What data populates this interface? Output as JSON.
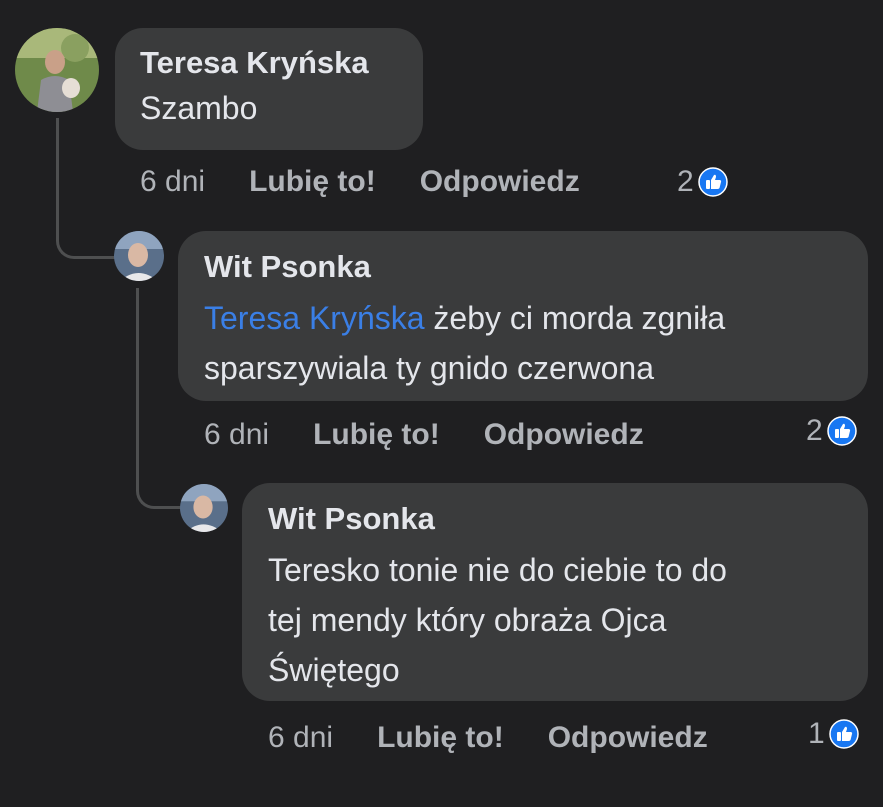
{
  "comments": [
    {
      "author": "Teresa Kryńska",
      "text": "Szambo",
      "time": "6 dni",
      "like_label": "Lubię to!",
      "reply_label": "Odpowiedz",
      "reaction_count": "2"
    },
    {
      "author": "Wit Psonka",
      "mention": "Teresa Kryńska",
      "text_line1": " żeby ci morda zgniła",
      "text_line2": "sparszywiala ty gnido czerwona",
      "time": "6 dni",
      "like_label": "Lubię to!",
      "reply_label": "Odpowiedz",
      "reaction_count": "2"
    },
    {
      "author": "Wit Psonka",
      "text_line1": "Teresko tonie nie do ciebie to do",
      "text_line2": "tej mendy który obraża Ojca",
      "text_line3": "Świętego",
      "time": "6 dni",
      "like_label": "Lubię to!",
      "reply_label": "Odpowiedz",
      "reaction_count": "1"
    }
  ],
  "colors": {
    "background": "#1f1f21",
    "bubble": "#3a3b3c",
    "mention": "#3a7fe6",
    "like_blue": "#1877f2",
    "secondary_text": "#b0b3b8"
  }
}
